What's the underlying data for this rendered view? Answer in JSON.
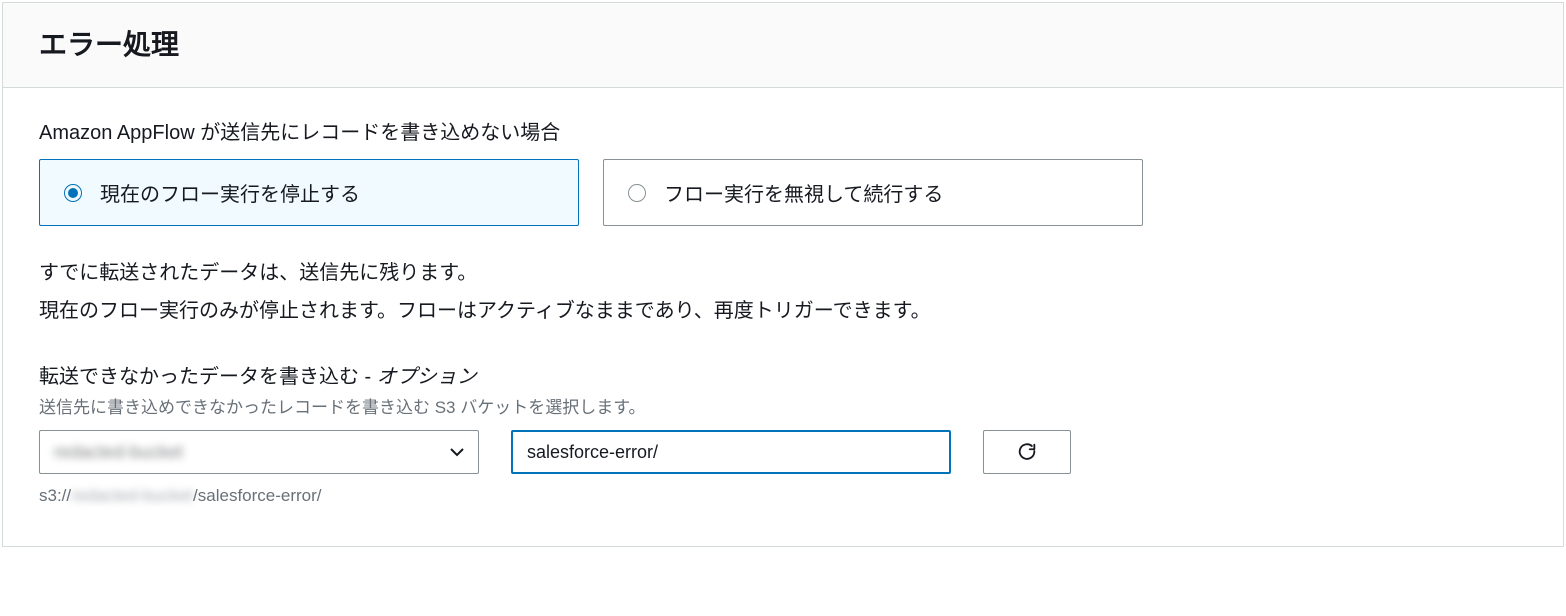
{
  "panel": {
    "title": "エラー処理"
  },
  "writeFail": {
    "label": "Amazon AppFlow が送信先にレコードを書き込めない場合",
    "option1": "現在のフロー実行を停止する",
    "option2": "フロー実行を無視して続行する"
  },
  "desc": {
    "line1": "すでに転送されたデータは、送信先に残ります。",
    "line2": "現在のフロー実行のみが停止されます。フローはアクティブなままであり、再度トリガーできます。"
  },
  "unwritten": {
    "label_main": "転送できなかったデータを書き込む",
    "label_sep": " - ",
    "label_optional": "オプション",
    "hint": "送信先に書き込めできなかったレコードを書き込む S3 バケットを選択します。",
    "bucket_value": "redacted-bucket",
    "prefix_value": "salesforce-error/",
    "path_prefix": "s3://",
    "path_bucket": "redacted-bucket",
    "path_sep": "/",
    "path_suffix": "salesforce-error/"
  }
}
